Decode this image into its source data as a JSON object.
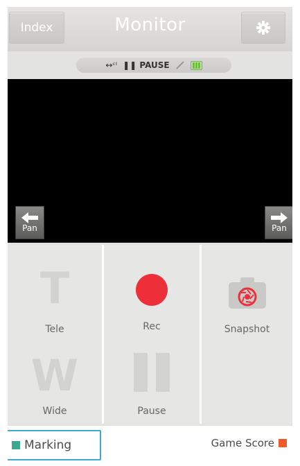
{
  "header": {
    "index_label": "Index",
    "title": "Monitor",
    "settings_icon": "gear-icon"
  },
  "status": {
    "connection_icon": "wifi-direct-icon",
    "connection_text": "↔ᶜᴵ",
    "pause_icon": "pause-icon",
    "pause_text": "PAUSE",
    "link_icon": "link-icon",
    "battery_icon": "battery-icon"
  },
  "pan": {
    "left_label": "Pan",
    "right_label": "Pan"
  },
  "controls": {
    "tele": {
      "glyph": "T",
      "label": "Tele"
    },
    "rec": {
      "label": "Rec"
    },
    "snapshot": {
      "label": "Snapshot"
    },
    "wide": {
      "glyph": "W",
      "label": "Wide"
    },
    "pause": {
      "label": "Pause"
    }
  },
  "bottom": {
    "marking_label": "Marking",
    "game_score_label": "Game Score"
  },
  "colors": {
    "rec": "#ed2f3a",
    "marking": "#3aa98f",
    "game_score": "#f05a28",
    "highlight": "#3aa9d6",
    "battery": "#6bbd3a"
  }
}
